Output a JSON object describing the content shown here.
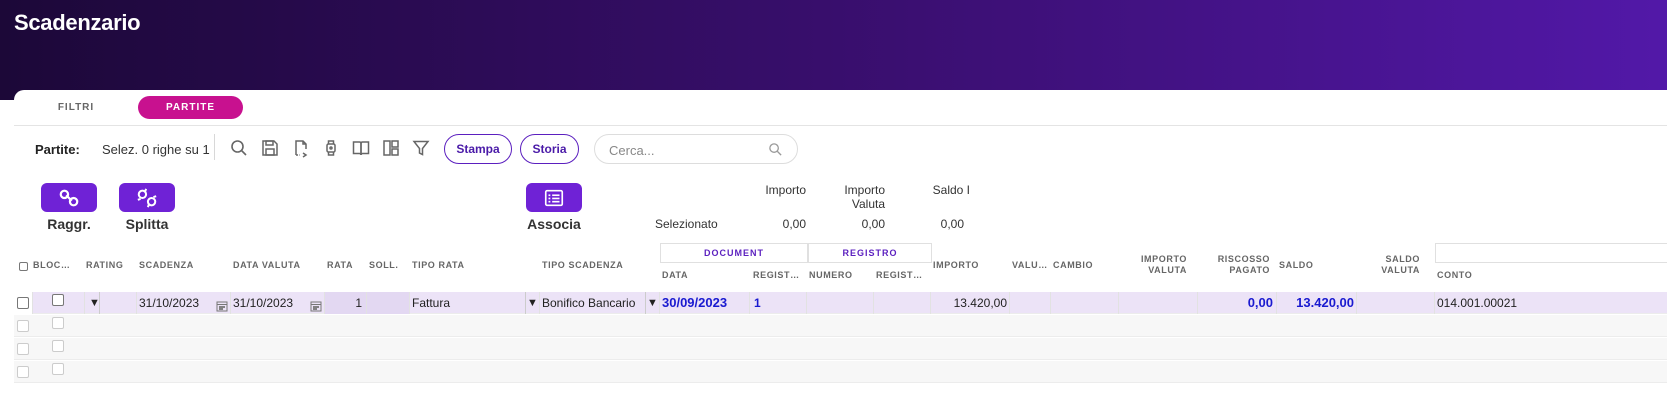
{
  "app": {
    "title": "Scadenzario"
  },
  "tabs": [
    {
      "label": "FILTRI",
      "active": false
    },
    {
      "label": "PARTITE",
      "active": true
    }
  ],
  "toolbar": {
    "label": "Partite:",
    "selection": "Selez. 0 righe su 1",
    "icons": [
      "search-icon",
      "save-icon",
      "export-icon",
      "watch-icon",
      "book-icon",
      "layout-icon",
      "filter-icon"
    ],
    "stampa_label": "Stampa",
    "storia_label": "Storia",
    "search_placeholder": "Cerca..."
  },
  "actions": {
    "raggr": "Raggr.",
    "splitta": "Splitta",
    "associa": "Associa"
  },
  "summary": {
    "label": "Selezionato",
    "importo_header": "Importo",
    "importo_valuta_header_1": "Importo",
    "importo_valuta_header_2": "Valuta",
    "saldo_header": "Saldo I",
    "importo": "0,00",
    "importo_valuta": "0,00",
    "saldo": "0,00"
  },
  "groups": {
    "document": "DOCUMENT",
    "registro": "REGISTRO"
  },
  "columns": {
    "blocco": "BLOC…",
    "rating": "RATING",
    "scadenza": "SCADENZA",
    "data_valuta": "DATA VALUTA",
    "rata": "RATA",
    "soll": "SOLL.",
    "tipo_rata": "TIPO RATA",
    "tipo_scadenza": "TIPO SCADENZA",
    "data": "DATA",
    "regist_1": "REGIST…",
    "numero": "NUMERO",
    "regist_2": "REGIST…",
    "importo": "IMPORTO",
    "valuta": "VALU…",
    "cambio": "CAMBIO",
    "importo_valuta_1": "IMPORTO",
    "importo_valuta_2": "VALUTA",
    "riscosso_1": "RISCOSSO",
    "riscosso_2": "PAGATO",
    "saldo": "SALDO",
    "saldo_valuta_1": "SALDO",
    "saldo_valuta_2": "VALUTA",
    "conto": "CONTO"
  },
  "row": {
    "scadenza": "31/10/2023",
    "data_valuta": "31/10/2023",
    "rata": "1",
    "tipo_rata": "Fattura",
    "tipo_scadenza": "Bonifico Bancario",
    "data": "30/09/2023",
    "regist": "1",
    "importo": "13.420,00",
    "riscosso": "0,00",
    "saldo": "13.420,00",
    "conto": "014.001.00021"
  },
  "colors": {
    "accent": "#6f22d6",
    "tab_active": "#c8118f",
    "link_blue": "#1a1ad0"
  }
}
